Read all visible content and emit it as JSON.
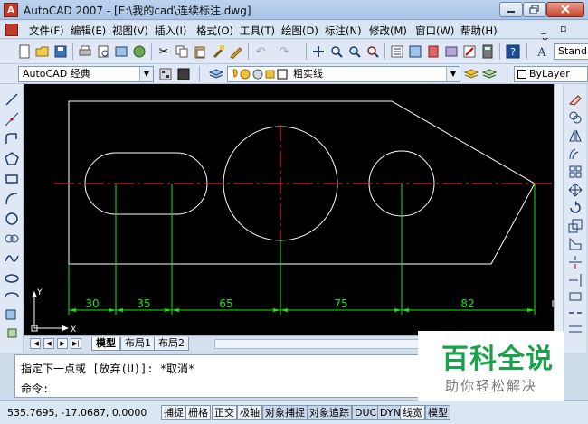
{
  "window": {
    "title": "AutoCAD 2007 - [E:\\我的cad\\连续标注.dwg]",
    "icon_letter": "A"
  },
  "menu": {
    "items": [
      "文件(F)",
      "编辑(E)",
      "视图(V)",
      "插入(I)",
      "格式(O)",
      "工具(T)",
      "绘图(D)",
      "标注(N)",
      "修改(M)",
      "窗口(W)",
      "帮助(H)"
    ],
    "mdi_controls": "_ ▫ ×"
  },
  "toolbar1": {
    "style_combo": "Standa"
  },
  "toolbar2": {
    "workspace": "AutoCAD 经典",
    "layer": "粗实线",
    "linetype": "ByLayer"
  },
  "canvas": {
    "background": "#000000",
    "ucs": {
      "y_label": "Y",
      "x_label": "X"
    },
    "dimensions": [
      {
        "label": "30"
      },
      {
        "label": "35"
      },
      {
        "label": "65"
      },
      {
        "label": "75"
      },
      {
        "label": "82"
      }
    ],
    "colors": {
      "geometry": "#ffffff",
      "centerline": "#ff3030",
      "dimension": "#19e619"
    }
  },
  "layout_tabs": {
    "tabs": [
      {
        "label": "模型",
        "active": true
      },
      {
        "label": "布局1",
        "active": false
      },
      {
        "label": "布局2",
        "active": false
      }
    ]
  },
  "command": {
    "line1": "指定下一点或 [放弃(U)]: *取消*",
    "line2": "命令:"
  },
  "status": {
    "coords": "535.7695, -17.0687, 0.0000",
    "buttons": [
      {
        "label": "捕捉",
        "pressed": false
      },
      {
        "label": "栅格",
        "pressed": false
      },
      {
        "label": "正交",
        "pressed": false
      },
      {
        "label": "极轴",
        "pressed": false
      },
      {
        "label": "对象捕捉",
        "pressed": true
      },
      {
        "label": "对象追踪",
        "pressed": true
      },
      {
        "label": "DUCS",
        "pressed": true
      },
      {
        "label": "DYN",
        "pressed": true
      },
      {
        "label": "线宽",
        "pressed": false
      },
      {
        "label": "模型",
        "pressed": true
      }
    ]
  },
  "watermark": {
    "title": "百科全说",
    "subtitle": "助你轻松解决"
  }
}
